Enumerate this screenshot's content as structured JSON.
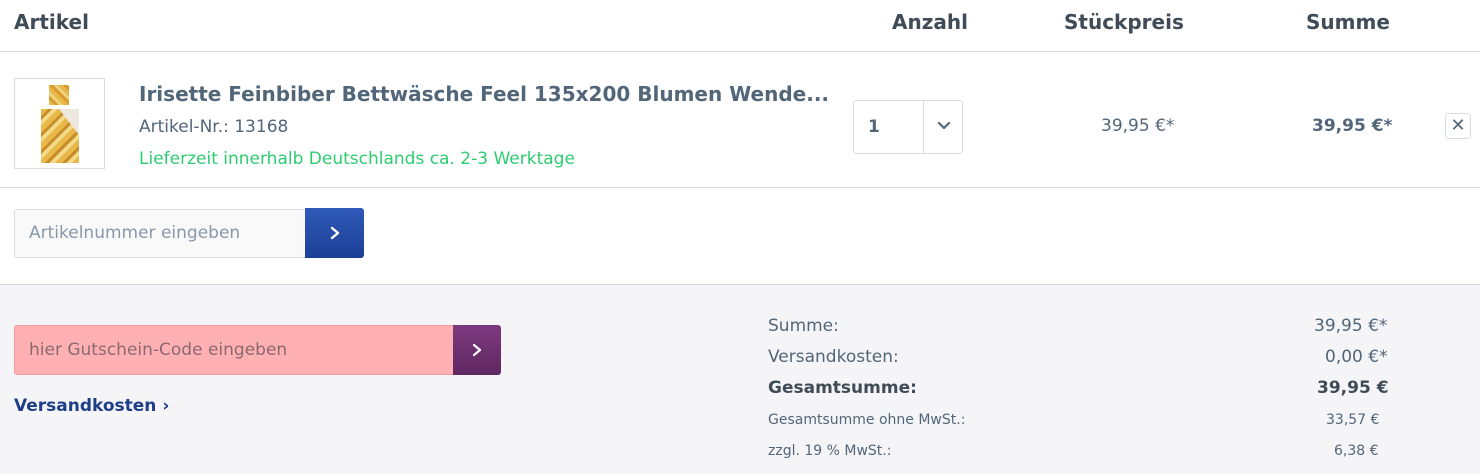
{
  "table_header": {
    "artikel": "Artikel",
    "anzahl": "Anzahl",
    "stueckpreis": "Stückpreis",
    "summe": "Summe"
  },
  "cart_item": {
    "title": "Irisette Feinbiber Bettwäsche Feel 135x200 Blumen Wende...",
    "article_number": "Artikel-Nr.: 13168",
    "delivery_time": "Lieferzeit innerhalb Deutschlands ca. 2-3 Werktage",
    "quantity": "1",
    "unit_price": "39,95 €*",
    "total": "39,95 €*",
    "remove_label": "✕",
    "image_icon": "bedding-product-image",
    "delivery_color": "#2ecc71"
  },
  "add_article": {
    "placeholder": "Artikelnummer eingeben",
    "button_color": "#2451a8"
  },
  "voucher": {
    "placeholder": "hier Gutschein-Code eingeben",
    "button_color": "#6b2d6d",
    "input_color": "#ffb0b2"
  },
  "shipping_link": "Versandkosten ›",
  "summary": {
    "summe_label": "Summe:",
    "summe_value": "39,95 €*",
    "versand_label": "Versandkosten:",
    "versand_value": "0,00 €*",
    "gesamt_label": "Gesamtsumme:",
    "gesamt_value": "39,95 €",
    "netto_label": "Gesamtsumme ohne MwSt.:",
    "netto_value": "33,57 €",
    "mwst_label": "zzgl. 19 % MwSt.:",
    "mwst_value": "6,38 €"
  }
}
